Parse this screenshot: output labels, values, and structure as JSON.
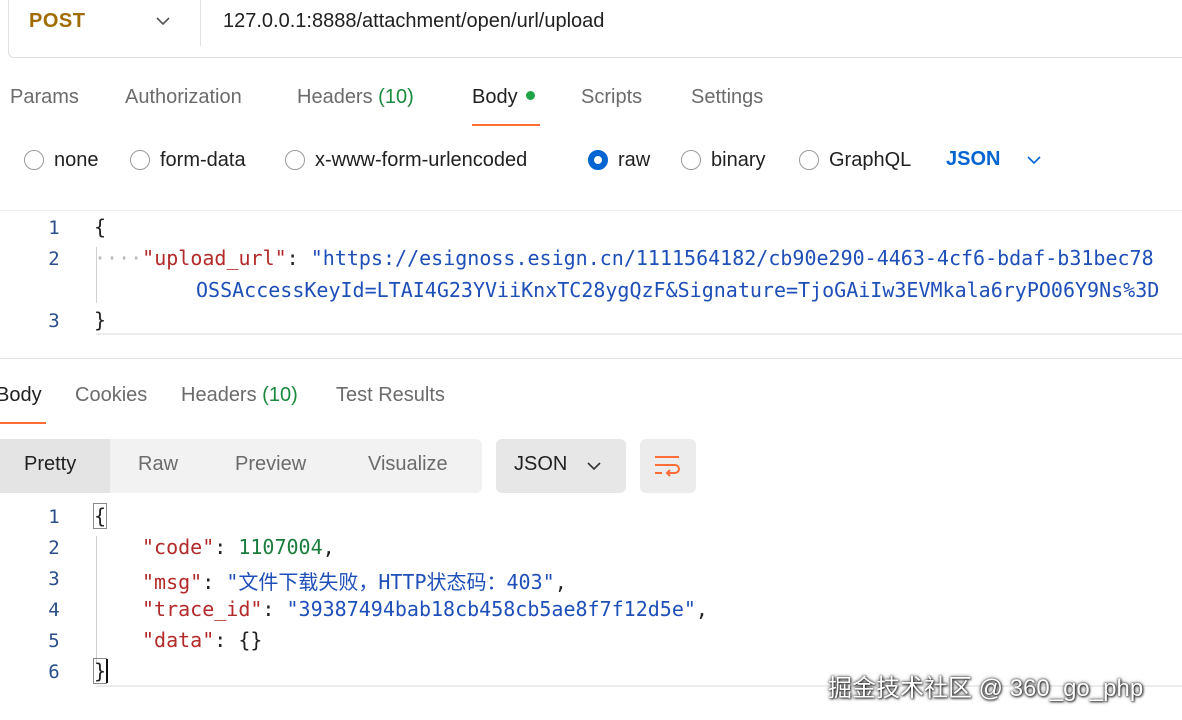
{
  "colors": {
    "accent_orange": "#ff6c37",
    "method_color": "#a06c00",
    "link_blue": "#0265d2",
    "count_green": "#1a8a3f"
  },
  "request": {
    "method": "POST",
    "url": "127.0.0.1:8888/attachment/open/url/upload"
  },
  "request_tabs": [
    {
      "label": "Params"
    },
    {
      "label": "Authorization"
    },
    {
      "label": "Headers",
      "count": "(10)"
    },
    {
      "label": "Body"
    },
    {
      "label": "Scripts"
    },
    {
      "label": "Settings"
    }
  ],
  "body_types": [
    {
      "label": "none",
      "checked": false
    },
    {
      "label": "form-data",
      "checked": false
    },
    {
      "label": "x-www-form-urlencoded",
      "checked": false
    },
    {
      "label": "raw",
      "checked": true
    },
    {
      "label": "binary",
      "checked": false
    },
    {
      "label": "GraphQL",
      "checked": false
    }
  ],
  "body_language": "JSON",
  "request_body": {
    "line_numbers": [
      "1",
      "2",
      "3"
    ],
    "open_brace": "{",
    "close_brace": "}",
    "indent_dots": "····",
    "key": "\"upload_url\"",
    "colon": ": ",
    "value_line1": "\"https://esignoss.esign.cn/1111564182/cb90e290-4463-4cf6-bdaf-b31bec78",
    "value_line2": "OSSAccessKeyId=LTAI4G23YViiKnxTC28ygQzF&Signature=TjoGAiIw3EVMkala6ryPO06Y9Ns%3D"
  },
  "response_tabs": [
    {
      "label": "Body"
    },
    {
      "label": "Cookies"
    },
    {
      "label": "Headers",
      "count": "(10)"
    },
    {
      "label": "Test Results"
    }
  ],
  "view_modes": [
    {
      "label": "Pretty"
    },
    {
      "label": "Raw"
    },
    {
      "label": "Preview"
    },
    {
      "label": "Visualize"
    }
  ],
  "response_language": "JSON",
  "response_body": {
    "line_numbers": [
      "1",
      "2",
      "3",
      "4",
      "5",
      "6"
    ],
    "open_brace": "{",
    "close_brace": "}",
    "code_key": "\"code\"",
    "code_value": "1107004",
    "msg_key": "\"msg\"",
    "msg_value": "\"文件下载失败，HTTP状态码：403\"",
    "trace_key": "\"trace_id\"",
    "trace_value": "\"39387494bab18cb458cb5ae8f7f12d5e\"",
    "data_key": "\"data\"",
    "data_value": "{}",
    "colon": ": ",
    "comma": ","
  },
  "watermark": "掘金技术社区 @ 360_go_php"
}
